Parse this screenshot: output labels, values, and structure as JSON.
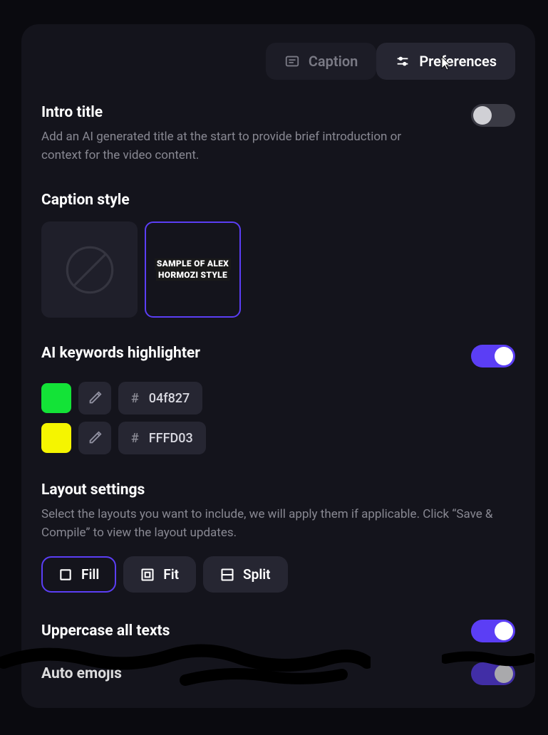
{
  "tabs": {
    "caption": "Caption",
    "preferences": "Preferences"
  },
  "intro": {
    "title": "Intro title",
    "desc": "Add an AI generated title at the start to provide brief introduction or context for the video content.",
    "enabled": false
  },
  "captionStyle": {
    "title": "Caption style",
    "options": {
      "sample_line1": "SAMPLE OF ALEX",
      "sample_line2": "HORMOZI STYLE"
    }
  },
  "keywords": {
    "title": "AI keywords highlighter",
    "enabled": true,
    "colors": [
      {
        "hex": "04f827",
        "swatch": "#13e337"
      },
      {
        "hex": "FFFD03",
        "swatch": "#f5f500"
      }
    ]
  },
  "layout": {
    "title": "Layout settings",
    "desc": "Select the layouts you want to include, we will apply them if applicable. Click “Save & Compile” to view the layout updates.",
    "fill": "Fill",
    "fit": "Fit",
    "split": "Split"
  },
  "uppercase": {
    "title": "Uppercase all texts",
    "enabled": true
  },
  "autoEmojis": {
    "title": "Auto emojis",
    "enabled": true
  }
}
